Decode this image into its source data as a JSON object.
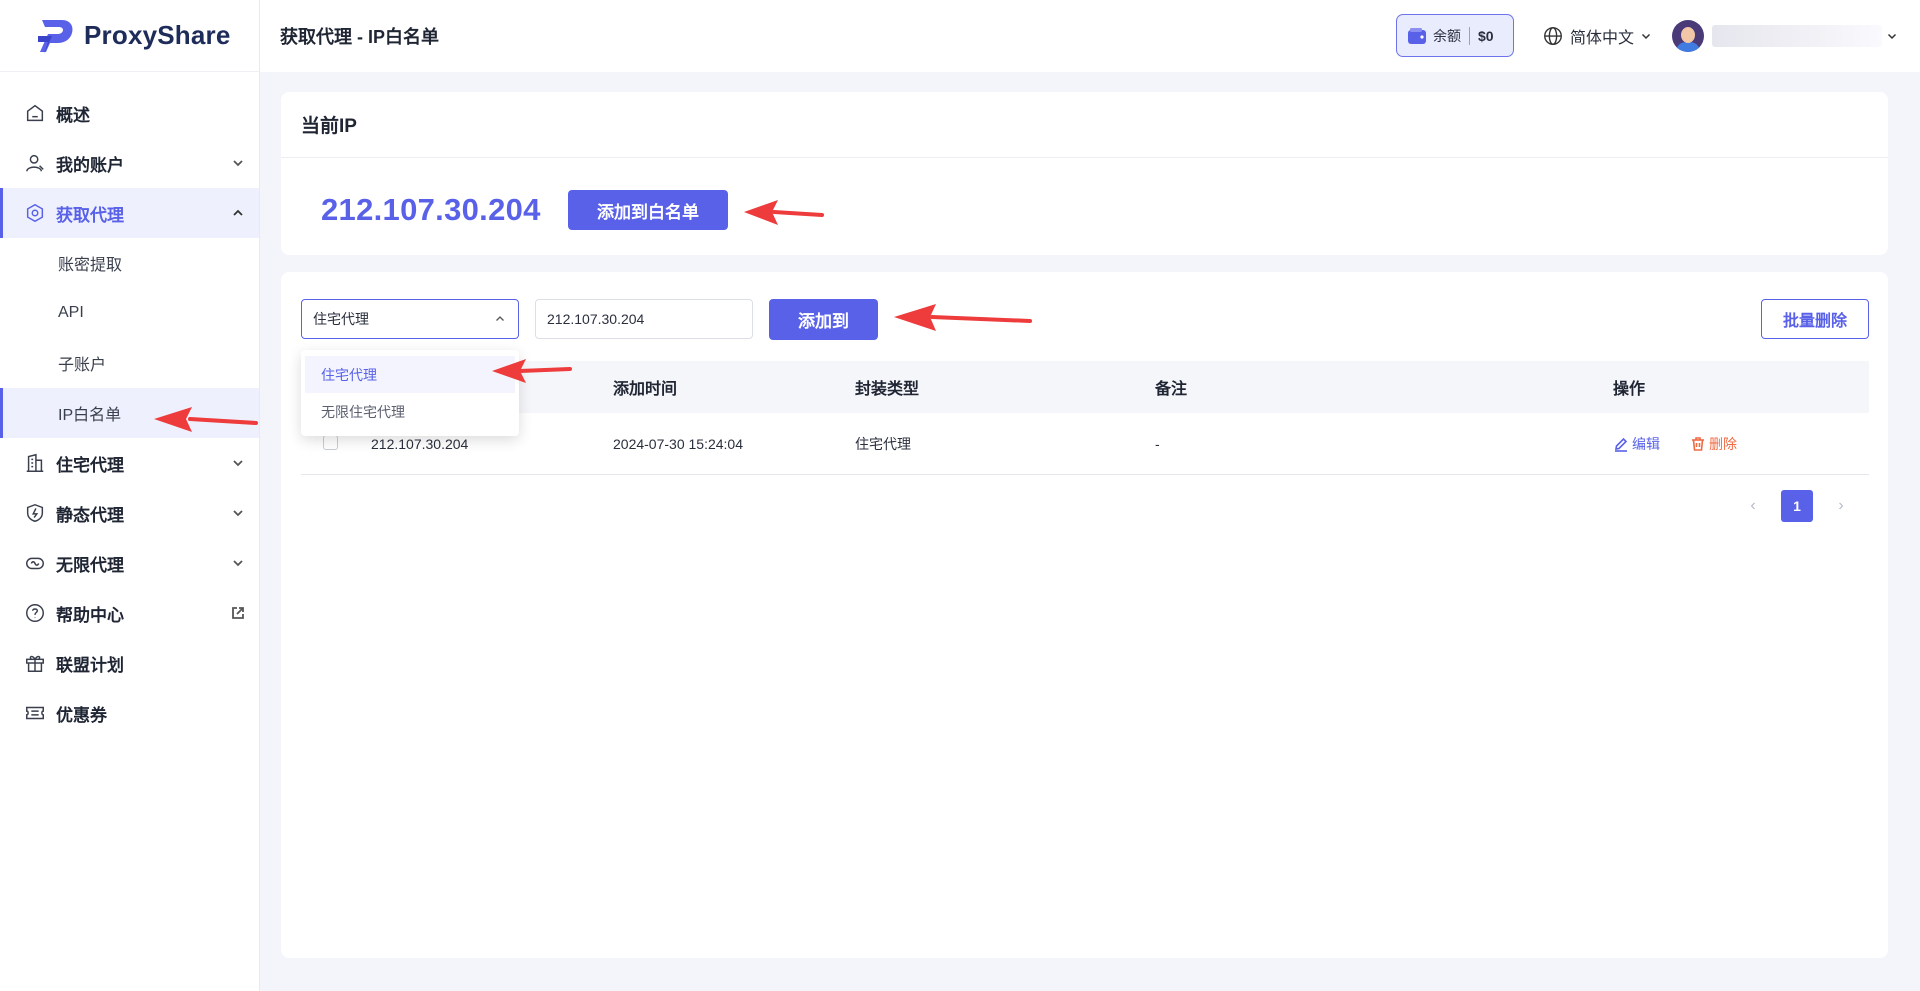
{
  "brand": {
    "name": "ProxyShare"
  },
  "header": {
    "title": "获取代理 - IP白名单",
    "balance_label": "余额",
    "balance_value": "$0",
    "language": "简体中文"
  },
  "sidebar": {
    "items": [
      {
        "label": "概述",
        "icon": "home-icon"
      },
      {
        "label": "我的账户",
        "icon": "user-icon"
      },
      {
        "label": "获取代理",
        "icon": "hexagon-icon"
      },
      {
        "label": "住宅代理",
        "icon": "building-icon"
      },
      {
        "label": "静态代理",
        "icon": "shield-bolt-icon"
      },
      {
        "label": "无限代理",
        "icon": "infinity-icon"
      },
      {
        "label": "帮助中心",
        "icon": "help-icon"
      },
      {
        "label": "联盟计划",
        "icon": "gift-icon"
      },
      {
        "label": "优惠券",
        "icon": "coupon-icon"
      }
    ],
    "sub_items": [
      "账密提取",
      "API",
      "子账户",
      "IP白名单"
    ]
  },
  "current_ip_card": {
    "title": "当前IP",
    "ip": "212.107.30.204",
    "add_button": "添加到白名单"
  },
  "whitelist": {
    "select_value": "住宅代理",
    "select_options": [
      "住宅代理",
      "无限住宅代理"
    ],
    "ip_input_value": "212.107.30.204",
    "add_button": "添加到",
    "batch_delete": "批量删除",
    "columns": [
      "添加时间",
      "封装类型",
      "备注",
      "操作"
    ],
    "rows": [
      {
        "ip": "212.107.30.204",
        "time": "2024-07-30 15:24:04",
        "type": "住宅代理",
        "note": "-",
        "edit": "编辑",
        "delete": "删除"
      }
    ],
    "current_page": "1"
  },
  "colors": {
    "accent": "#5961e8",
    "danger": "#f06a44",
    "annotation": "#ee3b3b"
  }
}
